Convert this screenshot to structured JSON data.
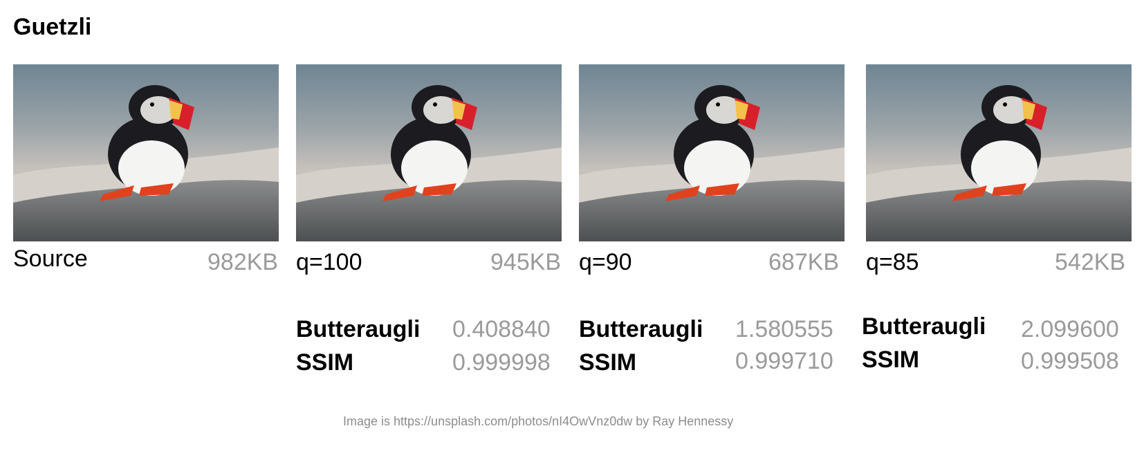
{
  "title": "Guetzli",
  "panels": [
    {
      "label": "Source",
      "size": "982KB"
    },
    {
      "label": "q=100",
      "size": "945KB",
      "metrics": {
        "butteraugli_label": "Butteraugli",
        "butteraugli": "0.408840",
        "ssim_label": "SSIM",
        "ssim": "0.999998"
      }
    },
    {
      "label": "q=90",
      "size": "687KB",
      "metrics": {
        "butteraugli_label": "Butteraugli",
        "butteraugli": "1.580555",
        "ssim_label": "SSIM",
        "ssim": "0.999710"
      }
    },
    {
      "label": "q=85",
      "size": "542KB",
      "metrics": {
        "butteraugli_label": "Butteraugli",
        "butteraugli": "2.099600",
        "ssim_label": "SSIM",
        "ssim": "0.999508"
      }
    }
  ],
  "credit": "Image is https://unsplash.com/photos/nI4OwVnz0dw by Ray Hennessy"
}
